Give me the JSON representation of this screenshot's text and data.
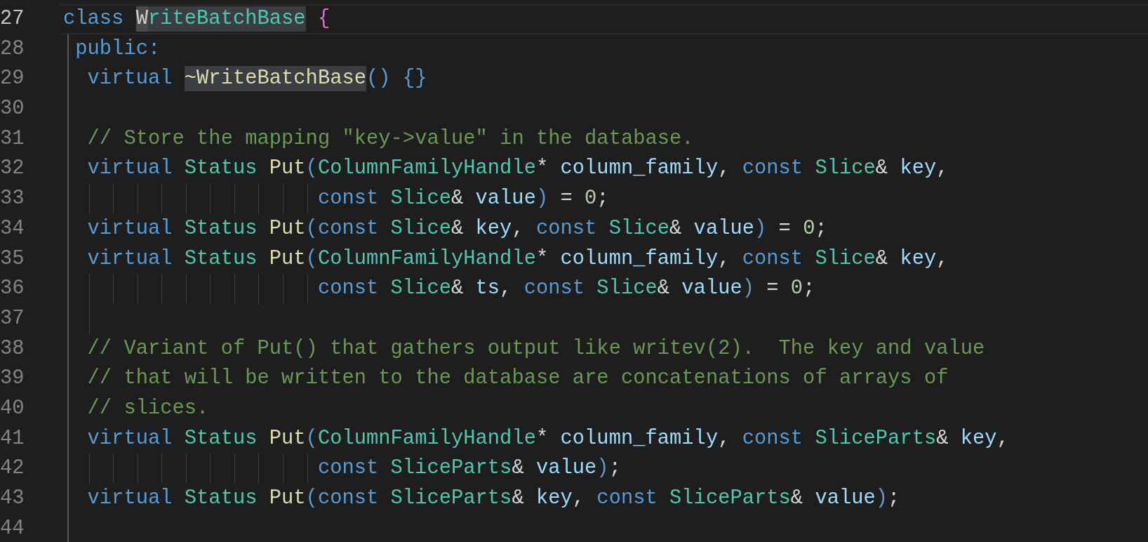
{
  "editor": {
    "lines": [
      {
        "number": "27",
        "current": true,
        "kind": "class",
        "tokens": [
          {
            "text": "class ",
            "kind": "keyword"
          },
          {
            "text": "W",
            "kind": "type-cursor"
          },
          {
            "text": "riteBatchBase",
            "kind": "type-highlight"
          },
          {
            "text": " {",
            "kind": "brace"
          }
        ]
      },
      {
        "number": "28",
        "current": false,
        "kind": "access",
        "tokens": [
          {
            "text": "public:",
            "kind": "keyword"
          }
        ]
      },
      {
        "number": "29",
        "current": false,
        "kind": "member",
        "tokens": [
          {
            "text": "virtual ",
            "kind": "keyword"
          },
          {
            "text": "~WriteBatchBase",
            "kind": "function-highlight"
          },
          {
            "text": "() {}",
            "kind": "punct"
          }
        ]
      },
      {
        "number": "30",
        "current": false,
        "kind": "blank"
      },
      {
        "number": "31",
        "current": false,
        "kind": "member",
        "tokens": [
          {
            "text": "// Store the mapping \"key->value\" in the database.",
            "kind": "comment"
          }
        ]
      },
      {
        "number": "32",
        "current": false,
        "kind": "member",
        "tokens": [
          {
            "text": "virtual ",
            "kind": "keyword"
          },
          {
            "text": "Status ",
            "kind": "type"
          },
          {
            "text": "Put",
            "kind": "function"
          },
          {
            "text": "(",
            "kind": "punct"
          },
          {
            "text": "ColumnFamilyHandle",
            "kind": "type"
          },
          {
            "text": "* ",
            "kind": "plain"
          },
          {
            "text": "column_family",
            "kind": "variable"
          },
          {
            "text": ", ",
            "kind": "plain"
          },
          {
            "text": "const ",
            "kind": "keyword"
          },
          {
            "text": "Slice",
            "kind": "type"
          },
          {
            "text": "& ",
            "kind": "plain"
          },
          {
            "text": "key",
            "kind": "variable"
          },
          {
            "text": ",",
            "kind": "plain"
          }
        ]
      },
      {
        "number": "33",
        "current": false,
        "kind": "continuation",
        "tokens": [
          {
            "text": "const ",
            "kind": "keyword"
          },
          {
            "text": "Slice",
            "kind": "type"
          },
          {
            "text": "& ",
            "kind": "plain"
          },
          {
            "text": "value",
            "kind": "variable"
          },
          {
            "text": ")",
            "kind": "punct"
          },
          {
            "text": " = ",
            "kind": "plain"
          },
          {
            "text": "0",
            "kind": "number"
          },
          {
            "text": ";",
            "kind": "plain"
          }
        ]
      },
      {
        "number": "34",
        "current": false,
        "kind": "member",
        "tokens": [
          {
            "text": "virtual ",
            "kind": "keyword"
          },
          {
            "text": "Status ",
            "kind": "type"
          },
          {
            "text": "Put",
            "kind": "function"
          },
          {
            "text": "(",
            "kind": "punct"
          },
          {
            "text": "const ",
            "kind": "keyword"
          },
          {
            "text": "Slice",
            "kind": "type"
          },
          {
            "text": "& ",
            "kind": "plain"
          },
          {
            "text": "key",
            "kind": "variable"
          },
          {
            "text": ", ",
            "kind": "plain"
          },
          {
            "text": "const ",
            "kind": "keyword"
          },
          {
            "text": "Slice",
            "kind": "type"
          },
          {
            "text": "& ",
            "kind": "plain"
          },
          {
            "text": "value",
            "kind": "variable"
          },
          {
            "text": ")",
            "kind": "punct"
          },
          {
            "text": " = ",
            "kind": "plain"
          },
          {
            "text": "0",
            "kind": "number"
          },
          {
            "text": ";",
            "kind": "plain"
          }
        ]
      },
      {
        "number": "35",
        "current": false,
        "kind": "member",
        "tokens": [
          {
            "text": "virtual ",
            "kind": "keyword"
          },
          {
            "text": "Status ",
            "kind": "type"
          },
          {
            "text": "Put",
            "kind": "function"
          },
          {
            "text": "(",
            "kind": "punct"
          },
          {
            "text": "ColumnFamilyHandle",
            "kind": "type"
          },
          {
            "text": "* ",
            "kind": "plain"
          },
          {
            "text": "column_family",
            "kind": "variable"
          },
          {
            "text": ", ",
            "kind": "plain"
          },
          {
            "text": "const ",
            "kind": "keyword"
          },
          {
            "text": "Slice",
            "kind": "type"
          },
          {
            "text": "& ",
            "kind": "plain"
          },
          {
            "text": "key",
            "kind": "variable"
          },
          {
            "text": ",",
            "kind": "plain"
          }
        ]
      },
      {
        "number": "36",
        "current": false,
        "kind": "continuation",
        "tokens": [
          {
            "text": "const ",
            "kind": "keyword"
          },
          {
            "text": "Slice",
            "kind": "type"
          },
          {
            "text": "& ",
            "kind": "plain"
          },
          {
            "text": "ts",
            "kind": "variable"
          },
          {
            "text": ", ",
            "kind": "plain"
          },
          {
            "text": "const ",
            "kind": "keyword"
          },
          {
            "text": "Slice",
            "kind": "type"
          },
          {
            "text": "& ",
            "kind": "plain"
          },
          {
            "text": "value",
            "kind": "variable"
          },
          {
            "text": ")",
            "kind": "punct"
          },
          {
            "text": " = ",
            "kind": "plain"
          },
          {
            "text": "0",
            "kind": "number"
          },
          {
            "text": ";",
            "kind": "plain"
          }
        ]
      },
      {
        "number": "37",
        "current": false,
        "kind": "blank-guide"
      },
      {
        "number": "38",
        "current": false,
        "kind": "member",
        "tokens": [
          {
            "text": "// Variant of Put() that gathers output like writev(2).  The key and value",
            "kind": "comment"
          }
        ]
      },
      {
        "number": "39",
        "current": false,
        "kind": "member",
        "tokens": [
          {
            "text": "// that will be written to the database are concatenations of arrays of",
            "kind": "comment"
          }
        ]
      },
      {
        "number": "40",
        "current": false,
        "kind": "member",
        "tokens": [
          {
            "text": "// slices.",
            "kind": "comment"
          }
        ]
      },
      {
        "number": "41",
        "current": false,
        "kind": "member",
        "tokens": [
          {
            "text": "virtual ",
            "kind": "keyword"
          },
          {
            "text": "Status ",
            "kind": "type"
          },
          {
            "text": "Put",
            "kind": "function"
          },
          {
            "text": "(",
            "kind": "punct"
          },
          {
            "text": "ColumnFamilyHandle",
            "kind": "type"
          },
          {
            "text": "* ",
            "kind": "plain"
          },
          {
            "text": "column_family",
            "kind": "variable"
          },
          {
            "text": ", ",
            "kind": "plain"
          },
          {
            "text": "const ",
            "kind": "keyword"
          },
          {
            "text": "SliceParts",
            "kind": "type"
          },
          {
            "text": "& ",
            "kind": "plain"
          },
          {
            "text": "key",
            "kind": "variable"
          },
          {
            "text": ",",
            "kind": "plain"
          }
        ]
      },
      {
        "number": "42",
        "current": false,
        "kind": "continuation",
        "tokens": [
          {
            "text": "const ",
            "kind": "keyword"
          },
          {
            "text": "SliceParts",
            "kind": "type"
          },
          {
            "text": "& ",
            "kind": "plain"
          },
          {
            "text": "value",
            "kind": "variable"
          },
          {
            "text": ")",
            "kind": "punct"
          },
          {
            "text": ";",
            "kind": "plain"
          }
        ]
      },
      {
        "number": "43",
        "current": false,
        "kind": "member",
        "tokens": [
          {
            "text": "virtual ",
            "kind": "keyword"
          },
          {
            "text": "Status ",
            "kind": "type"
          },
          {
            "text": "Put",
            "kind": "function"
          },
          {
            "text": "(",
            "kind": "punct"
          },
          {
            "text": "const ",
            "kind": "keyword"
          },
          {
            "text": "SliceParts",
            "kind": "type"
          },
          {
            "text": "& ",
            "kind": "plain"
          },
          {
            "text": "key",
            "kind": "variable"
          },
          {
            "text": ", ",
            "kind": "plain"
          },
          {
            "text": "const ",
            "kind": "keyword"
          },
          {
            "text": "SliceParts",
            "kind": "type"
          },
          {
            "text": "& ",
            "kind": "plain"
          },
          {
            "text": "value",
            "kind": "variable"
          },
          {
            "text": ")",
            "kind": "punct"
          },
          {
            "text": ";",
            "kind": "plain"
          }
        ]
      },
      {
        "number": "44",
        "current": false,
        "kind": "blank"
      }
    ]
  }
}
